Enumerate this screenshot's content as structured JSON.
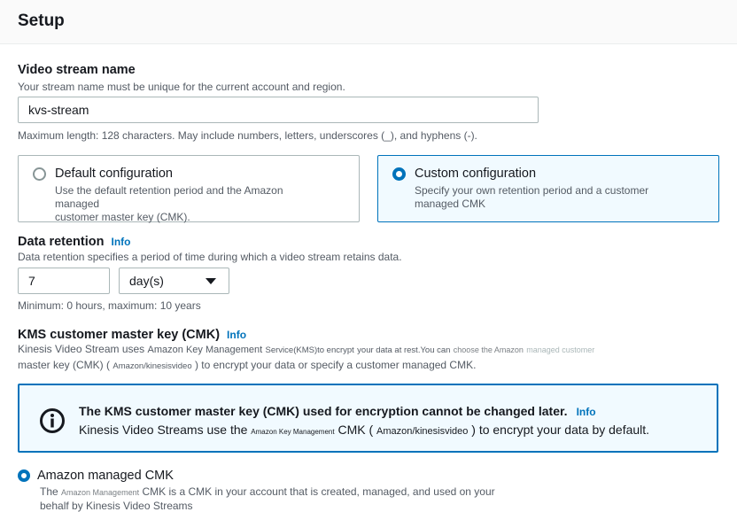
{
  "header": {
    "title": "Setup"
  },
  "stream_name": {
    "label": "Video stream name",
    "description": "Your stream name must be unique for the current account and region.",
    "value": "kvs-stream",
    "constraint": "Maximum length: 128 characters. May include numbers, letters, underscores (_), and hyphens (-)."
  },
  "config_options": {
    "default": {
      "title": "Default configuration",
      "line1": "Use the default retention period and the Amazon managed",
      "line2": "customer master key (CMK).",
      "selected": false
    },
    "custom": {
      "title": "Custom configuration",
      "line1": "Specify your own retention period and a customer",
      "line2": "managed CMK",
      "selected": true
    }
  },
  "data_retention": {
    "label": "Data retention",
    "info": "Info",
    "description": "Data retention specifies a period of time during which a video stream retains data.",
    "value": "7",
    "unit": "day(s)",
    "constraint": "Minimum: 0 hours, maximum: 10 years"
  },
  "kms": {
    "label": "KMS customer master key (CMK)",
    "info": "Info",
    "desc_1a": "Kinesis Video Stream uses",
    "desc_1b": "Amazon Key Management",
    "desc_1c": "Service(KMS)to encrypt",
    "desc_1d": "your data at rest.You can",
    "desc_1e": "choose the Amazon",
    "desc_1f": "managed customer",
    "desc_2a": "master key (CMK) (",
    "desc_2b": "Amazon/kinesisvideo",
    "desc_2c": ") to encrypt your data or specify a customer managed CMK."
  },
  "alert": {
    "icon": "info-icon",
    "title": "The KMS customer master key (CMK) used for encryption cannot be changed later.",
    "info": "Info",
    "body_a": "Kinesis Video Streams use the",
    "body_b": "Amazon Key Management",
    "body_c": "CMK (",
    "body_d": "Amazon/kinesisvideo",
    "body_e": ") to encrypt your data by default."
  },
  "amazon_managed": {
    "label": "Amazon managed CMK",
    "selected": true,
    "desc_a": "The",
    "desc_b": "Amazon Management",
    "desc_c": "CMK is a CMK in your account that is created, managed, and used on your",
    "desc_line2": "behalf by Kinesis Video Streams"
  },
  "colors": {
    "accent": "#0073bb",
    "selected_bg": "#f1faff"
  }
}
